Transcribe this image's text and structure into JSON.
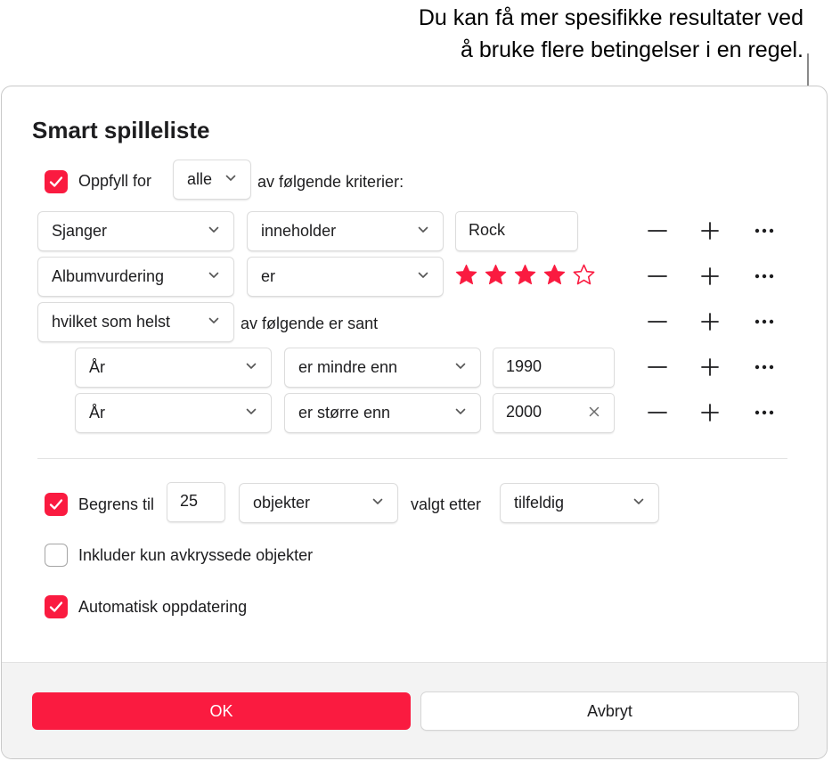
{
  "callout": {
    "line1": "Du kan få mer spesifikke resultater ved",
    "line2": "å bruke flere betingelser i en regel."
  },
  "dialog": {
    "title": "Smart spilleliste",
    "match": {
      "checked": true,
      "label_before": "Oppfyll for",
      "selector": "alle",
      "label_after": "av følgende kriterier:"
    },
    "rules": [
      {
        "field": "Sjanger",
        "operator": "inneholder",
        "value": "Rock"
      },
      {
        "field": "Albumvurdering",
        "operator": "er",
        "rating": 4,
        "rating_max": 5
      }
    ],
    "nested": {
      "selector": "hvilket som helst",
      "label": "av følgende er sant",
      "rules": [
        {
          "field": "År",
          "operator": "er mindre enn",
          "value": "1990"
        },
        {
          "field": "År",
          "operator": "er større enn",
          "value": "2000"
        }
      ]
    },
    "limit": {
      "checked": true,
      "label": "Begrens til",
      "value": "25",
      "unit": "objekter",
      "selected_by_label": "valgt etter",
      "selected_by": "tilfeldig"
    },
    "checked_only": {
      "checked": false,
      "label": "Inkluder kun avkryssede objekter"
    },
    "live_update": {
      "checked": true,
      "label": "Automatisk oppdatering"
    },
    "buttons": {
      "ok": "OK",
      "cancel": "Avbryt"
    }
  },
  "colors": {
    "accent": "#fa1b40",
    "star": "#fa1b40",
    "footer": "#f3f3f3"
  }
}
